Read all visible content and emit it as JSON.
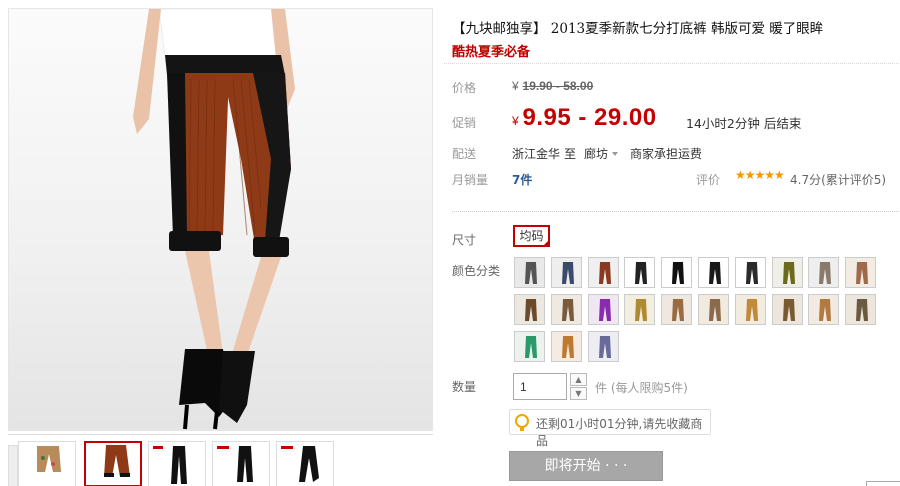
{
  "product": {
    "title": "【九块邮独享】 2013夏季新款七分打底裤 韩版可爱 暖了眼眸",
    "subtitle": "酷热夏季必备"
  },
  "price": {
    "orig_label": "价格",
    "currency": "¥",
    "orig_range": "19.90 - 58.00",
    "promo_label": "促销",
    "promo_range": "9.95 - 29.00",
    "countdown": "14小时2分钟 后结束"
  },
  "shipping": {
    "label": "配送",
    "from": "浙江金华",
    "to_word": "至",
    "destination": "廊坊",
    "fee_note": "商家承担运费"
  },
  "sales": {
    "label": "月销量",
    "value": "7件",
    "rating_label": "评价",
    "stars": "★★★★★",
    "rating_text": "4.7分(累计评价5)"
  },
  "options": {
    "size_label": "尺寸",
    "size_selected": "均码",
    "color_label": "颜色分类",
    "swatches": [
      {
        "bg": "#e9e9e9",
        "leg": "#555555"
      },
      {
        "bg": "#eeeeee",
        "leg": "#3a4a6a"
      },
      {
        "bg": "#f0f0f0",
        "leg": "#8a3a1e"
      },
      {
        "bg": "#ffffff",
        "leg": "#222222"
      },
      {
        "bg": "#ffffff",
        "leg": "#111111"
      },
      {
        "bg": "#ffffff",
        "leg": "#1a1a1a"
      },
      {
        "bg": "#ffffff",
        "leg": "#2a2a2a"
      },
      {
        "bg": "#efefe8",
        "leg": "#6b6a1a"
      },
      {
        "bg": "#eeeeee",
        "leg": "#8a7a6a"
      },
      {
        "bg": "#f2ece4",
        "leg": "#a06a4a"
      },
      {
        "bg": "#ece8e0",
        "leg": "#6a4a2a"
      },
      {
        "bg": "#eeeae2",
        "leg": "#7a5a3a"
      },
      {
        "bg": "#efe8f2",
        "leg": "#8a2ab0"
      },
      {
        "bg": "#f2efe0",
        "leg": "#b08a30"
      },
      {
        "bg": "#efe8e0",
        "leg": "#9a6a40"
      },
      {
        "bg": "#f0eadf",
        "leg": "#8a6a4a"
      },
      {
        "bg": "#f2ece0",
        "leg": "#c08a3a"
      },
      {
        "bg": "#ede6dc",
        "leg": "#7a5a30"
      },
      {
        "bg": "#f2ebe2",
        "leg": "#b07a40"
      },
      {
        "bg": "#ece6dc",
        "leg": "#6a5a40"
      },
      {
        "bg": "#eef2ee",
        "leg": "#2a9a6a"
      },
      {
        "bg": "#f4ece2",
        "leg": "#c07a30"
      },
      {
        "bg": "#ededf2",
        "leg": "#6a6a9a"
      }
    ]
  },
  "quantity": {
    "label": "数量",
    "value": "1",
    "up": "▲",
    "down": "▼",
    "limit_note": "件 (每人限购5件)"
  },
  "tip": {
    "text": "还剩01小时01分钟,请先收藏商品"
  },
  "buy_button": {
    "label": "即将开始 · · ·",
    "state": "disabled"
  }
}
